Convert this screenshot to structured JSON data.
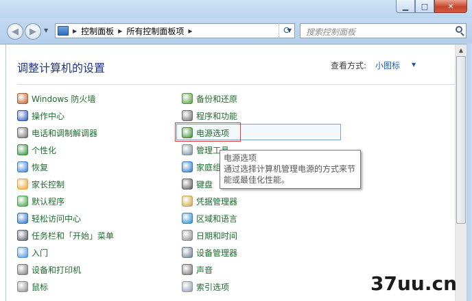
{
  "window": {
    "minimize_glyph": "▁",
    "maximize_glyph": "□",
    "close_glyph": "✕"
  },
  "nav": {
    "back_glyph": "◀",
    "forward_glyph": "▶",
    "breadcrumb": [
      "控制面板",
      "所有控制面板项"
    ],
    "search_placeholder": "搜索控制面板"
  },
  "header": {
    "title": "调整计算机的设置",
    "view_label": "查看方式:",
    "view_value": "小图标"
  },
  "items_left": [
    {
      "label": "Windows 防火墙",
      "icon": "firewall-icon",
      "color": "#b85c2a"
    },
    {
      "label": "操作中心",
      "icon": "flag-icon",
      "color": "#2e56b5"
    },
    {
      "label": "电话和调制解调器",
      "icon": "phone-modem-icon",
      "color": "#6b6b6b"
    },
    {
      "label": "个性化",
      "icon": "monitor-icon",
      "color": "#2f8f3e"
    },
    {
      "label": "恢复",
      "icon": "recovery-icon",
      "color": "#3a7bd5"
    },
    {
      "label": "家长控制",
      "icon": "parental-control-icon",
      "color": "#e8a33a"
    },
    {
      "label": "默认程序",
      "icon": "default-programs-icon",
      "color": "#43a047"
    },
    {
      "label": "轻松访问中心",
      "icon": "ease-of-access-icon",
      "color": "#2d6fc7"
    },
    {
      "label": "任务栏和「开始」菜单",
      "icon": "taskbar-icon",
      "color": "#555c66"
    },
    {
      "label": "入门",
      "icon": "getting-started-icon",
      "color": "#4a90d9"
    },
    {
      "label": "设备和打印机",
      "icon": "printer-icon",
      "color": "#7a7a7a"
    },
    {
      "label": "鼠标",
      "icon": "mouse-icon",
      "color": "#8c8c8c"
    }
  ],
  "items_right": [
    {
      "label": "备份和还原",
      "icon": "backup-icon",
      "color": "#4f9a3c"
    },
    {
      "label": "程序和功能",
      "icon": "programs-icon",
      "color": "#6d6d6d"
    },
    {
      "label": "电源选项",
      "icon": "power-options-icon",
      "color": "#3c8a2e"
    },
    {
      "label": "管理工具",
      "icon": "admin-tools-icon",
      "color": "#7c8a99"
    },
    {
      "label": "家庭组",
      "icon": "homegroup-icon",
      "color": "#2f76c9"
    },
    {
      "label": "键盘",
      "icon": "keyboard-icon",
      "color": "#5a5a5a"
    },
    {
      "label": "凭据管理器",
      "icon": "credential-icon",
      "color": "#c9a24a"
    },
    {
      "label": "区域和语言",
      "icon": "region-icon",
      "color": "#2d86c9"
    },
    {
      "label": "日期和时间",
      "icon": "clock-icon",
      "color": "#8a8a8a"
    },
    {
      "label": "设备管理器",
      "icon": "device-manager-icon",
      "color": "#6a7c8f"
    },
    {
      "label": "声音",
      "icon": "sound-icon",
      "color": "#707070"
    },
    {
      "label": "索引选项",
      "icon": "index-icon",
      "color": "#8f9aa8"
    }
  ],
  "tooltip": {
    "title": "电源选项",
    "line1": "通过选择计算机管理电源的方式来节",
    "line2": "能或最佳化性能。"
  },
  "scrollbar": {
    "up_glyph": "▲"
  },
  "watermark": "37uu.cn"
}
